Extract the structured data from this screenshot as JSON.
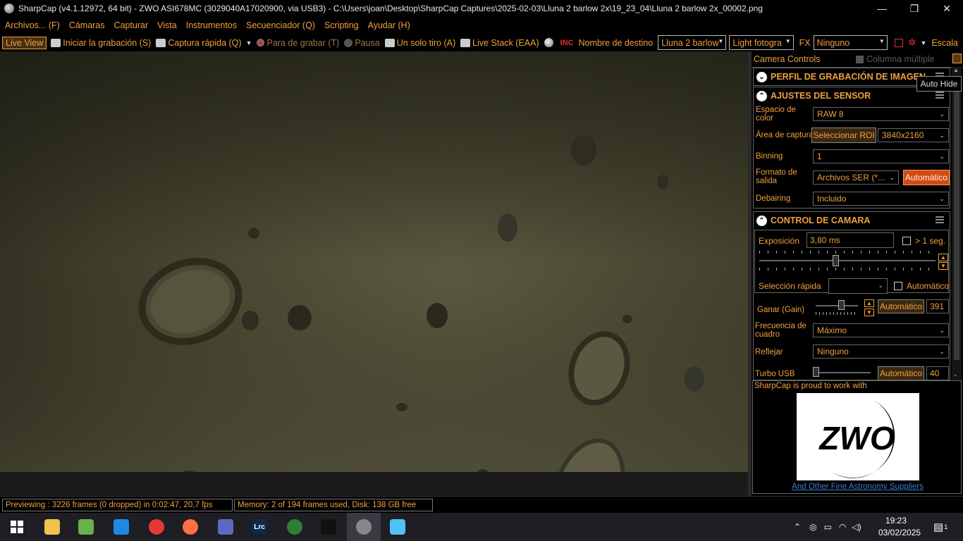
{
  "window": {
    "title": "SharpCap (v4.1.12972, 64 bit) - ZWO ASI678MC (3029040A17020900, via USB3) - C:\\Users\\joan\\Desktop\\SharpCap Captures\\2025-02-03\\Lluna 2 barlow 2x\\19_23_04\\Lluna 2 barlow 2x_00002.png",
    "minimize": "—",
    "maximize": "❐",
    "close": "✕"
  },
  "menu": [
    "Archivos... (F)",
    "Cámaras",
    "Capturar",
    "Vista",
    "Instrumentos",
    "Secuenciador (Q)",
    "Scripting",
    "Ayudar (H)"
  ],
  "toolbar": {
    "live_view": "Live View",
    "start_recording": "Iniciar la grabación (S)",
    "quick_capture": "Captura rápida (Q)",
    "stop_recording": "Para de grabar (T)",
    "pause": "Pausa",
    "single_shot": "Un solo tiro (A)",
    "live_stack": "Live Stack (EAA)",
    "target_name_label": "Nombre de destino",
    "target_name_value": "Lluna 2 barlow",
    "frame_type": "Light fotogra",
    "fx_label": "FX",
    "fx_value": "Ninguno",
    "scale_label": "Escala"
  },
  "panel": {
    "header": "Camera Controls",
    "multi_column": "Columna múltiple",
    "auto_hide_tooltip": "Auto Hide",
    "profile_section": "PERFIL DE GRABACIÓN DE IMAGEN",
    "sensor_section": {
      "title": "AJUSTES DEL SENSOR",
      "color_space_label": "Espacio de color",
      "color_space_value": "RAW 8",
      "capture_area_label": "Área de captura",
      "select_roi": "Seleccionar ROI",
      "capture_area_value": "3840x2160",
      "binning_label": "Binning",
      "binning_value": "1",
      "output_format_label": "Formato de salida",
      "output_format_value": "Archivos SER (*...",
      "output_format_auto": "Automático",
      "debayering_label": "Debairing",
      "debayering_value": "Incluido"
    },
    "camera_section": {
      "title": "CONTROL DE CAMARA",
      "exposure_label": "Exposición",
      "exposure_value": "3,80 ms",
      "over_1s": "> 1 seg.",
      "exposure_slider_fraction": 0.43,
      "quick_select_label": "Selección rápida",
      "quick_select_auto": "Automático",
      "gain_label": "Ganar (Gain)",
      "gain_auto": "Automático",
      "gain_value": "391",
      "gain_slider_fraction": 0.6,
      "frame_rate_label": "Frecuencia de cuadro",
      "frame_rate_value": "Máximo",
      "flip_label": "Reflejar",
      "flip_value": "Ninguno",
      "usb_turbo_label": "Turbo USB",
      "usb_turbo_auto": "Automático",
      "usb_turbo_value": "40",
      "usb_turbo_slider_fraction": 0.0
    },
    "sponsor": {
      "proud": "SharpCap is proud to work with",
      "logo_text": "ZWO",
      "link": "And Other Fine Astronomy Suppliers"
    }
  },
  "status": {
    "preview": "Previewing : 3226 frames (0 dropped) in 0:02:47, 20,7 fps",
    "memory": "Memory: 2 of 194 frames used, Disk: 138 GB free"
  },
  "taskbar": {
    "time": "19:23",
    "date": "03/02/2025",
    "notifications": "1",
    "apps": [
      {
        "name": "start-icon",
        "label": "",
        "color": "#ffffff"
      },
      {
        "name": "file-explorer-icon",
        "label": "",
        "color": "#f2c14e"
      },
      {
        "name": "notepad-icon",
        "label": "",
        "color": "#6ab04c"
      },
      {
        "name": "vscode-icon",
        "label": "",
        "color": "#1e88e5"
      },
      {
        "name": "chrome-icon",
        "label": "",
        "color": "#e53935"
      },
      {
        "name": "firefox-icon",
        "label": "",
        "color": "#ff7043"
      },
      {
        "name": "remote-desktop-icon",
        "label": "",
        "color": "#5c6bc0"
      },
      {
        "name": "lightroom-classic-icon",
        "label": "Lrc",
        "color": "#0d2a4a"
      },
      {
        "name": "app-green-icon",
        "label": "",
        "color": "#2e7d32"
      },
      {
        "name": "app-orbit-icon",
        "label": "",
        "color": "#111111"
      },
      {
        "name": "sharpcap-icon",
        "label": "",
        "color": "#888888"
      },
      {
        "name": "paint-icon",
        "label": "",
        "color": "#4fc3f7"
      }
    ]
  }
}
